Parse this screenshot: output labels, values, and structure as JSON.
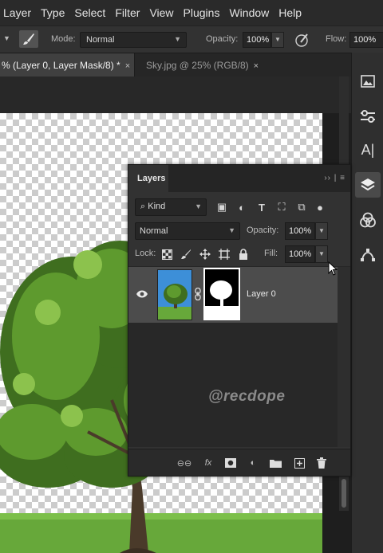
{
  "menu": [
    "Layer",
    "Type",
    "Select",
    "Filter",
    "View",
    "Plugins",
    "Window",
    "Help"
  ],
  "options": {
    "mode_label": "Mode:",
    "mode_value": "Normal",
    "opacity_label": "Opacity:",
    "opacity_value": "100%",
    "flow_label": "Flow:",
    "flow_value": "100%"
  },
  "tabs": {
    "active": "% (Layer 0, Layer Mask/8) *",
    "inactive": "Sky.jpg @ 25% (RGB/8)",
    "close_glyph": "×"
  },
  "layers_panel": {
    "title": "Layers",
    "kind_value": "Kind",
    "blend_value": "Normal",
    "opacity_label": "Opacity:",
    "opacity_value": "100%",
    "lock_label": "Lock:",
    "fill_label": "Fill:",
    "fill_value": "100%",
    "layers": [
      {
        "name": "Layer 0",
        "visible": true,
        "has_mask": true
      }
    ],
    "footer_fx": "fx"
  },
  "watermark": "@recdope",
  "colors": {
    "menu_bg": "#2a2a2a",
    "panel_bg": "#323232",
    "selected_layer": "#4c4c4c",
    "sky_blue": "#3d8fd8",
    "grass_green": "#67a83a"
  },
  "icons": {
    "tool": "brush-icon",
    "pressure": "airbrush-icon",
    "right_strip": [
      "libraries-icon",
      "adjustments-icon",
      "character-icon",
      "layers-icon",
      "channels-icon",
      "paths-icon"
    ],
    "filters": [
      "image-filter-icon",
      "adjustment-filter-icon",
      "type-filter-icon",
      "shape-filter-icon",
      "smartobject-filter-icon",
      "filter-toggle-icon"
    ],
    "locks": [
      "lock-transparent-icon",
      "lock-image-icon",
      "lock-position-icon",
      "lock-artboard-icon",
      "lock-all-icon"
    ],
    "footer": [
      "link-layers-icon",
      "fx-icon",
      "add-mask-icon",
      "adjustment-layer-icon",
      "group-icon",
      "new-layer-icon",
      "delete-icon"
    ]
  }
}
